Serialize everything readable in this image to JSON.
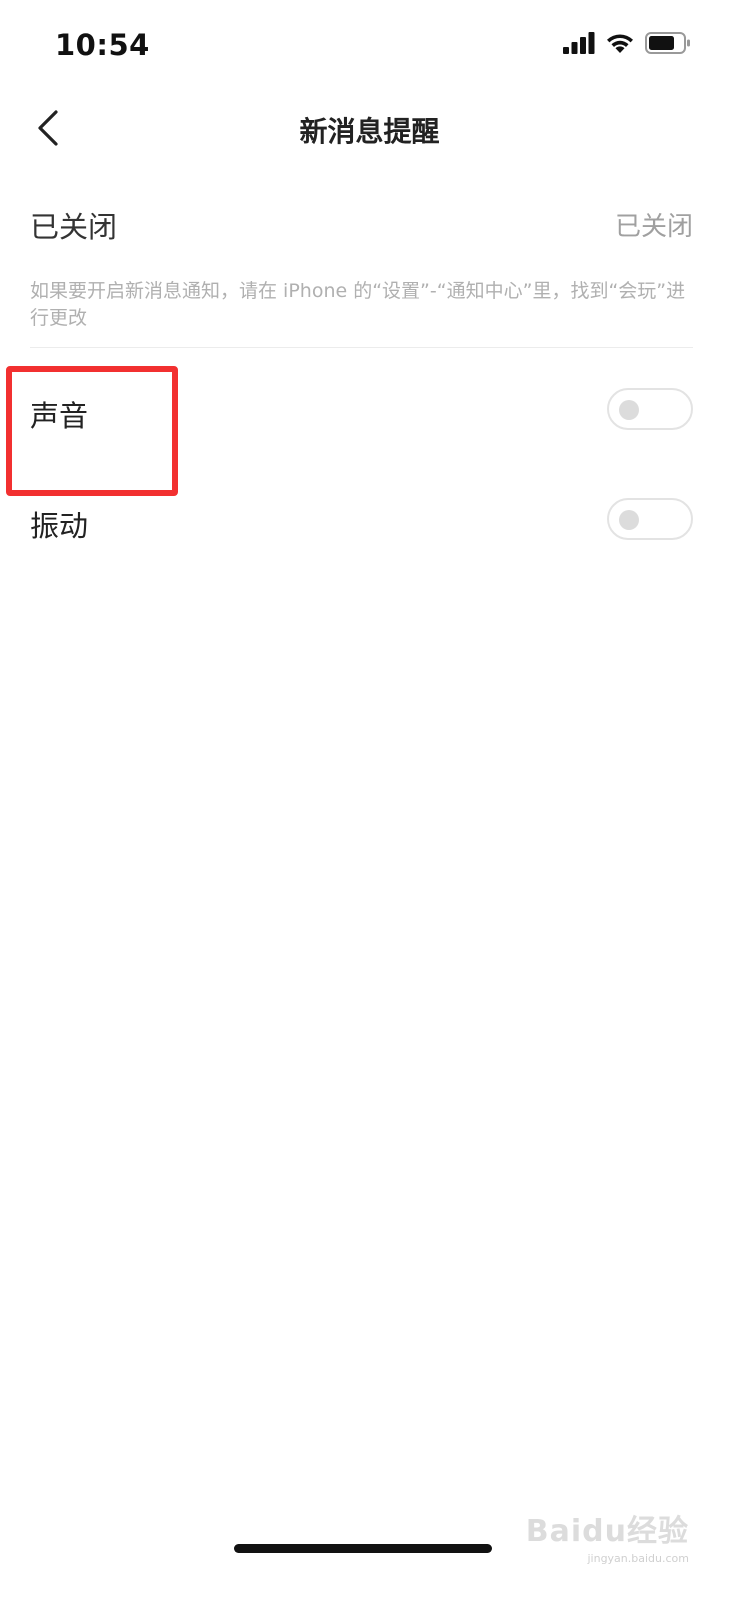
{
  "status_bar": {
    "time": "10:54",
    "icons": [
      "signal-icon",
      "wifi-icon",
      "battery-icon"
    ]
  },
  "nav": {
    "title": "新消息提醒",
    "back_icon": "chevron-left-icon"
  },
  "notification_status": {
    "label": "已关闭",
    "value": "已关闭",
    "hint": "如果要开启新消息通知，请在 iPhone 的“设置”-“通知中心”里，找到“会玩”进行更改"
  },
  "settings": [
    {
      "label": "声音",
      "enabled": false
    },
    {
      "label": "振动",
      "enabled": false
    }
  ],
  "watermark": {
    "main": "Baidu经验",
    "sub": "jingyan.baidu.com"
  },
  "colors": {
    "highlight": "#f23030",
    "hint_text": "#b0b0b0",
    "toggle_off": "#dcdcdc"
  }
}
